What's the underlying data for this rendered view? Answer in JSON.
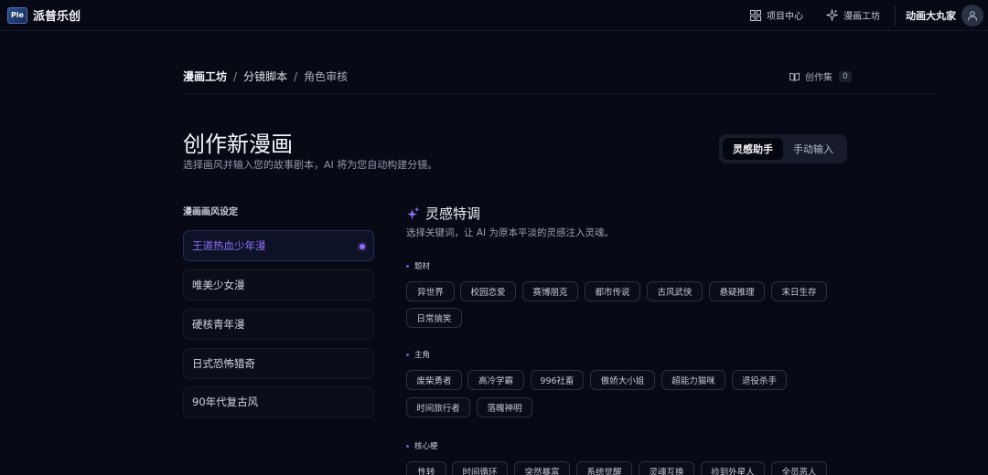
{
  "app": {
    "logo_badge": "Pie",
    "logo_text": "派普乐创"
  },
  "nav": {
    "projects": "项目中心",
    "workshop": "漫画工坊",
    "user_name": "动画大丸家"
  },
  "breadcrumb": {
    "root": "漫画工坊",
    "sep": "/",
    "mid": "分镜脚本",
    "last": "角色审核"
  },
  "works": {
    "label": "创作集",
    "count": "0"
  },
  "page": {
    "title": "创作新漫画",
    "subtitle": "选择画风并输入您的故事剧本，AI 将为您自动构建分镜。"
  },
  "mode": {
    "assistant": "灵感助手",
    "manual": "手动输入",
    "active": "assistant"
  },
  "styles": {
    "heading": "漫画画风设定",
    "items": [
      {
        "label": "王道热血少年漫",
        "active": true
      },
      {
        "label": "唯美少女漫",
        "active": false
      },
      {
        "label": "硬核青年漫",
        "active": false
      },
      {
        "label": "日式恐怖猎奇",
        "active": false
      },
      {
        "label": "90年代复古风",
        "active": false
      }
    ]
  },
  "inspiration": {
    "title": "灵感特调",
    "subtitle": "选择关键词，让 AI 为原本平淡的灵感注入灵魂。",
    "categories": [
      {
        "label": "题材",
        "tags": [
          "异世界",
          "校园恋爱",
          "赛博朋克",
          "都市传说",
          "古风武侠",
          "悬疑推理",
          "末日生存",
          "日常搞笑"
        ]
      },
      {
        "label": "主角",
        "tags": [
          "废柴勇者",
          "高冷学霸",
          "996社畜",
          "傲娇大小姐",
          "超能力猫咪",
          "退役杀手",
          "时间旅行者",
          "落魄神明"
        ]
      },
      {
        "label": "核心梗",
        "tags": [
          "性转",
          "时间循环",
          "突然暴富",
          "系统觉醒",
          "灵魂互换",
          "捡到外星人",
          "全员恶人"
        ]
      }
    ]
  },
  "colors": {
    "accent": "#8c6ff5",
    "background": "#070a14"
  }
}
